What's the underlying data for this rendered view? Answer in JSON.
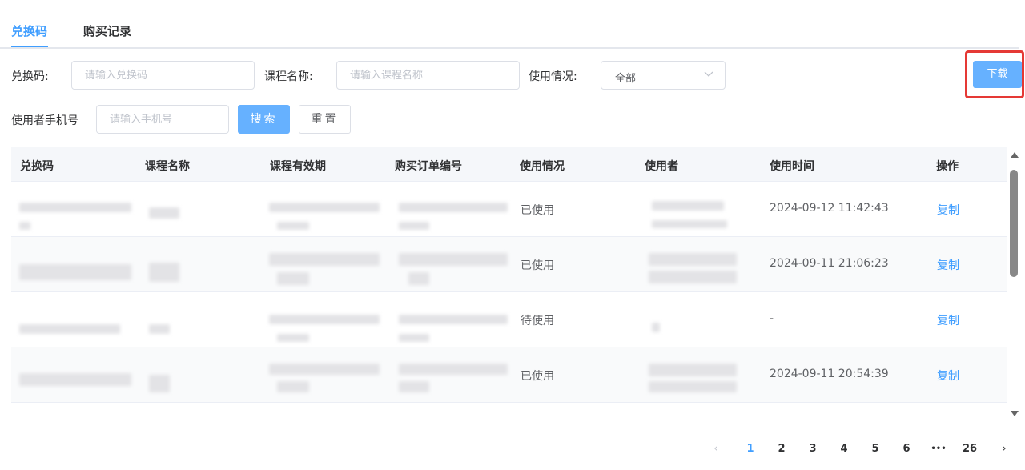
{
  "tabs": [
    {
      "label": "兑换码",
      "active": true
    },
    {
      "label": "购买记录",
      "active": false
    }
  ],
  "filters": {
    "code_label": "兑换码:",
    "code_placeholder": "请输入兑换码",
    "course_label": "课程名称:",
    "course_placeholder": "请输入课程名称",
    "usage_label": "使用情况:",
    "usage_value": "全部",
    "phone_label": "使用者手机号",
    "phone_placeholder": "请输入手机号",
    "search_label": "搜索",
    "reset_label": "重置",
    "download_label": "下载"
  },
  "table": {
    "headers": [
      "兑换码",
      "课程名称",
      "课程有效期",
      "购买订单编号",
      "使用情况",
      "使用者",
      "使用时间",
      "操作"
    ],
    "rows": [
      {
        "status": "已使用",
        "time": "2024-09-12 11:42:43",
        "action": "复制"
      },
      {
        "status": "已使用",
        "time": "2024-09-11 21:06:23",
        "action": "复制"
      },
      {
        "status": "待使用",
        "time": "-",
        "action": "复制"
      },
      {
        "status": "已使用",
        "time": "2024-09-11 20:54:39",
        "action": "复制"
      }
    ]
  },
  "pagination": {
    "prev": "‹",
    "pages": [
      "1",
      "2",
      "3",
      "4",
      "5",
      "6"
    ],
    "ellipsis": "•••",
    "last": "26",
    "next": "›",
    "current": "1"
  },
  "colors": {
    "accent": "#409eff",
    "highlight": "#e53935"
  }
}
